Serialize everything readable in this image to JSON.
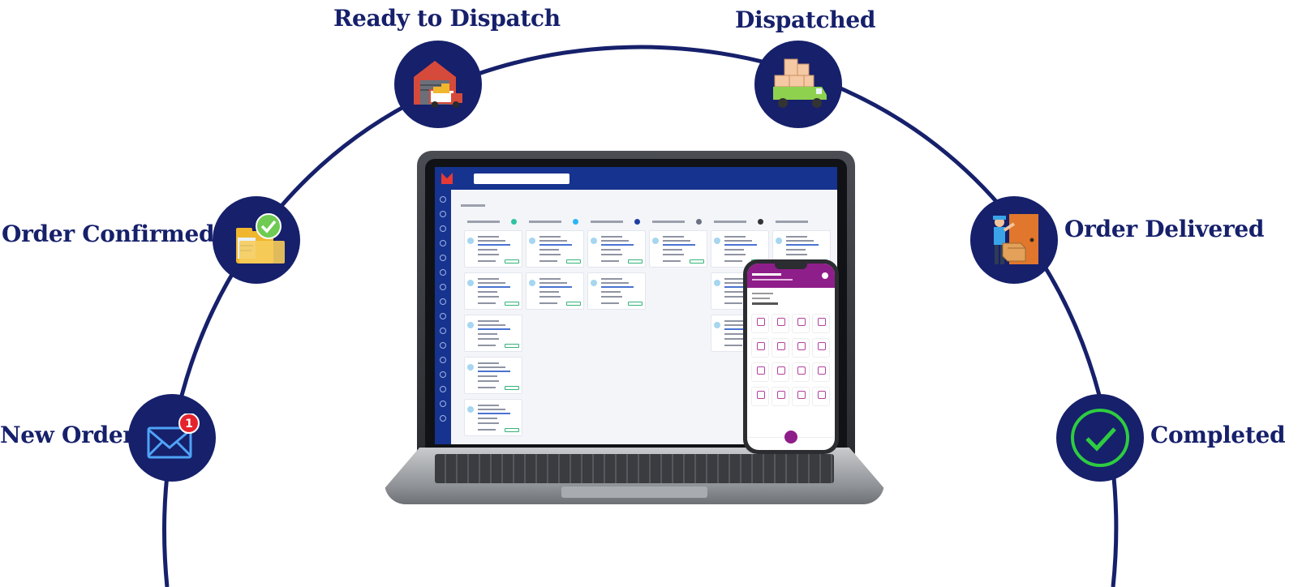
{
  "stages": [
    {
      "key": "new_order",
      "label": "New Order",
      "icon": "envelope-notification-icon",
      "badge": "1"
    },
    {
      "key": "order_confirmed",
      "label": "Order Confirmed",
      "icon": "folder-check-icon"
    },
    {
      "key": "ready_to_dispatch",
      "label": "Ready to Dispatch",
      "icon": "warehouse-truck-icon"
    },
    {
      "key": "dispatched",
      "label": "Dispatched",
      "icon": "loaded-truck-icon"
    },
    {
      "key": "order_delivered",
      "label": "Order Delivered",
      "icon": "delivery-person-icon"
    },
    {
      "key": "completed",
      "label": "Completed",
      "icon": "check-circle-icon"
    }
  ],
  "colors": {
    "navy": "#16206b",
    "app_blue": "#16338f",
    "phone_purple": "#8e1e8a",
    "complete_green": "#2ecc40",
    "badge_red": "#e5232c"
  }
}
